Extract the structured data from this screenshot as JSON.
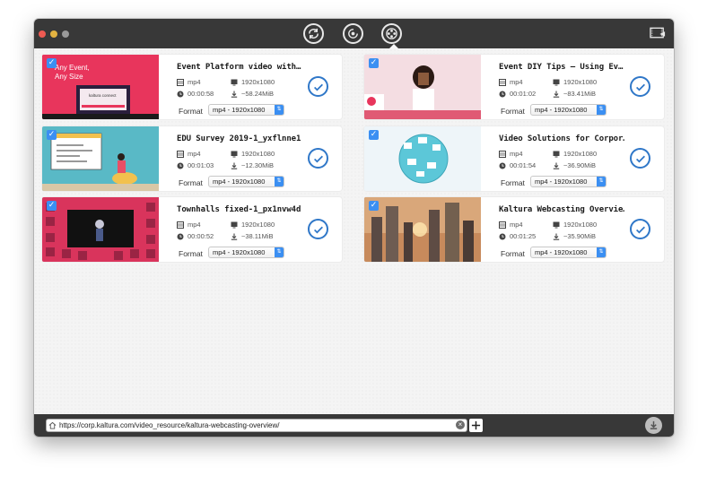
{
  "toolbar": {
    "tools": [
      {
        "name": "convert-icon"
      },
      {
        "name": "update-icon"
      },
      {
        "name": "film-reel-icon",
        "active": true
      }
    ],
    "right_icon": "screen-film-icon"
  },
  "videos": [
    {
      "title": "Event Platform video with…",
      "format": "mp4",
      "resolution": "1920x1080",
      "duration": "00:00:58",
      "size": "~58.24MiB",
      "format_select": "mp4 - 1920x1080",
      "thumb_text_1": "Any Event,",
      "thumb_text_2": "Any Size",
      "thumb_brand": "kaltura connect"
    },
    {
      "title": "Event DIY Tips – Using Ev…",
      "format": "mp4",
      "resolution": "1920x1080",
      "duration": "00:01:02",
      "size": "~83.41MiB",
      "format_select": "mp4 - 1920x1080"
    },
    {
      "title": "EDU Survey 2019-1_yxflnne1",
      "format": "mp4",
      "resolution": "1920x1080",
      "duration": "00:01:03",
      "size": "~12.30MiB",
      "format_select": "mp4 - 1920x1080"
    },
    {
      "title": "Video Solutions for Corpor…",
      "format": "mp4",
      "resolution": "1920x1080",
      "duration": "00:01:54",
      "size": "~36.90MiB",
      "format_select": "mp4 - 1920x1080"
    },
    {
      "title": "Townhalls fixed-1_px1nvw4d",
      "format": "mp4",
      "resolution": "1920x1080",
      "duration": "00:00:52",
      "size": "~38.11MiB",
      "format_select": "mp4 - 1920x1080"
    },
    {
      "title": "Kaltura Webcasting Overvie…",
      "format": "mp4",
      "resolution": "1920x1080",
      "duration": "00:01:25",
      "size": "~35.90MiB",
      "format_select": "mp4 - 1920x1080"
    }
  ],
  "labels": {
    "format": "Format"
  },
  "bottom": {
    "url": "https://corp.kaltura.com/video_resource/kaltura-webcasting-overview/"
  },
  "colors": {
    "accent": "#3b8ff2",
    "done": "#2f77c8",
    "titlebar": "#383838"
  }
}
